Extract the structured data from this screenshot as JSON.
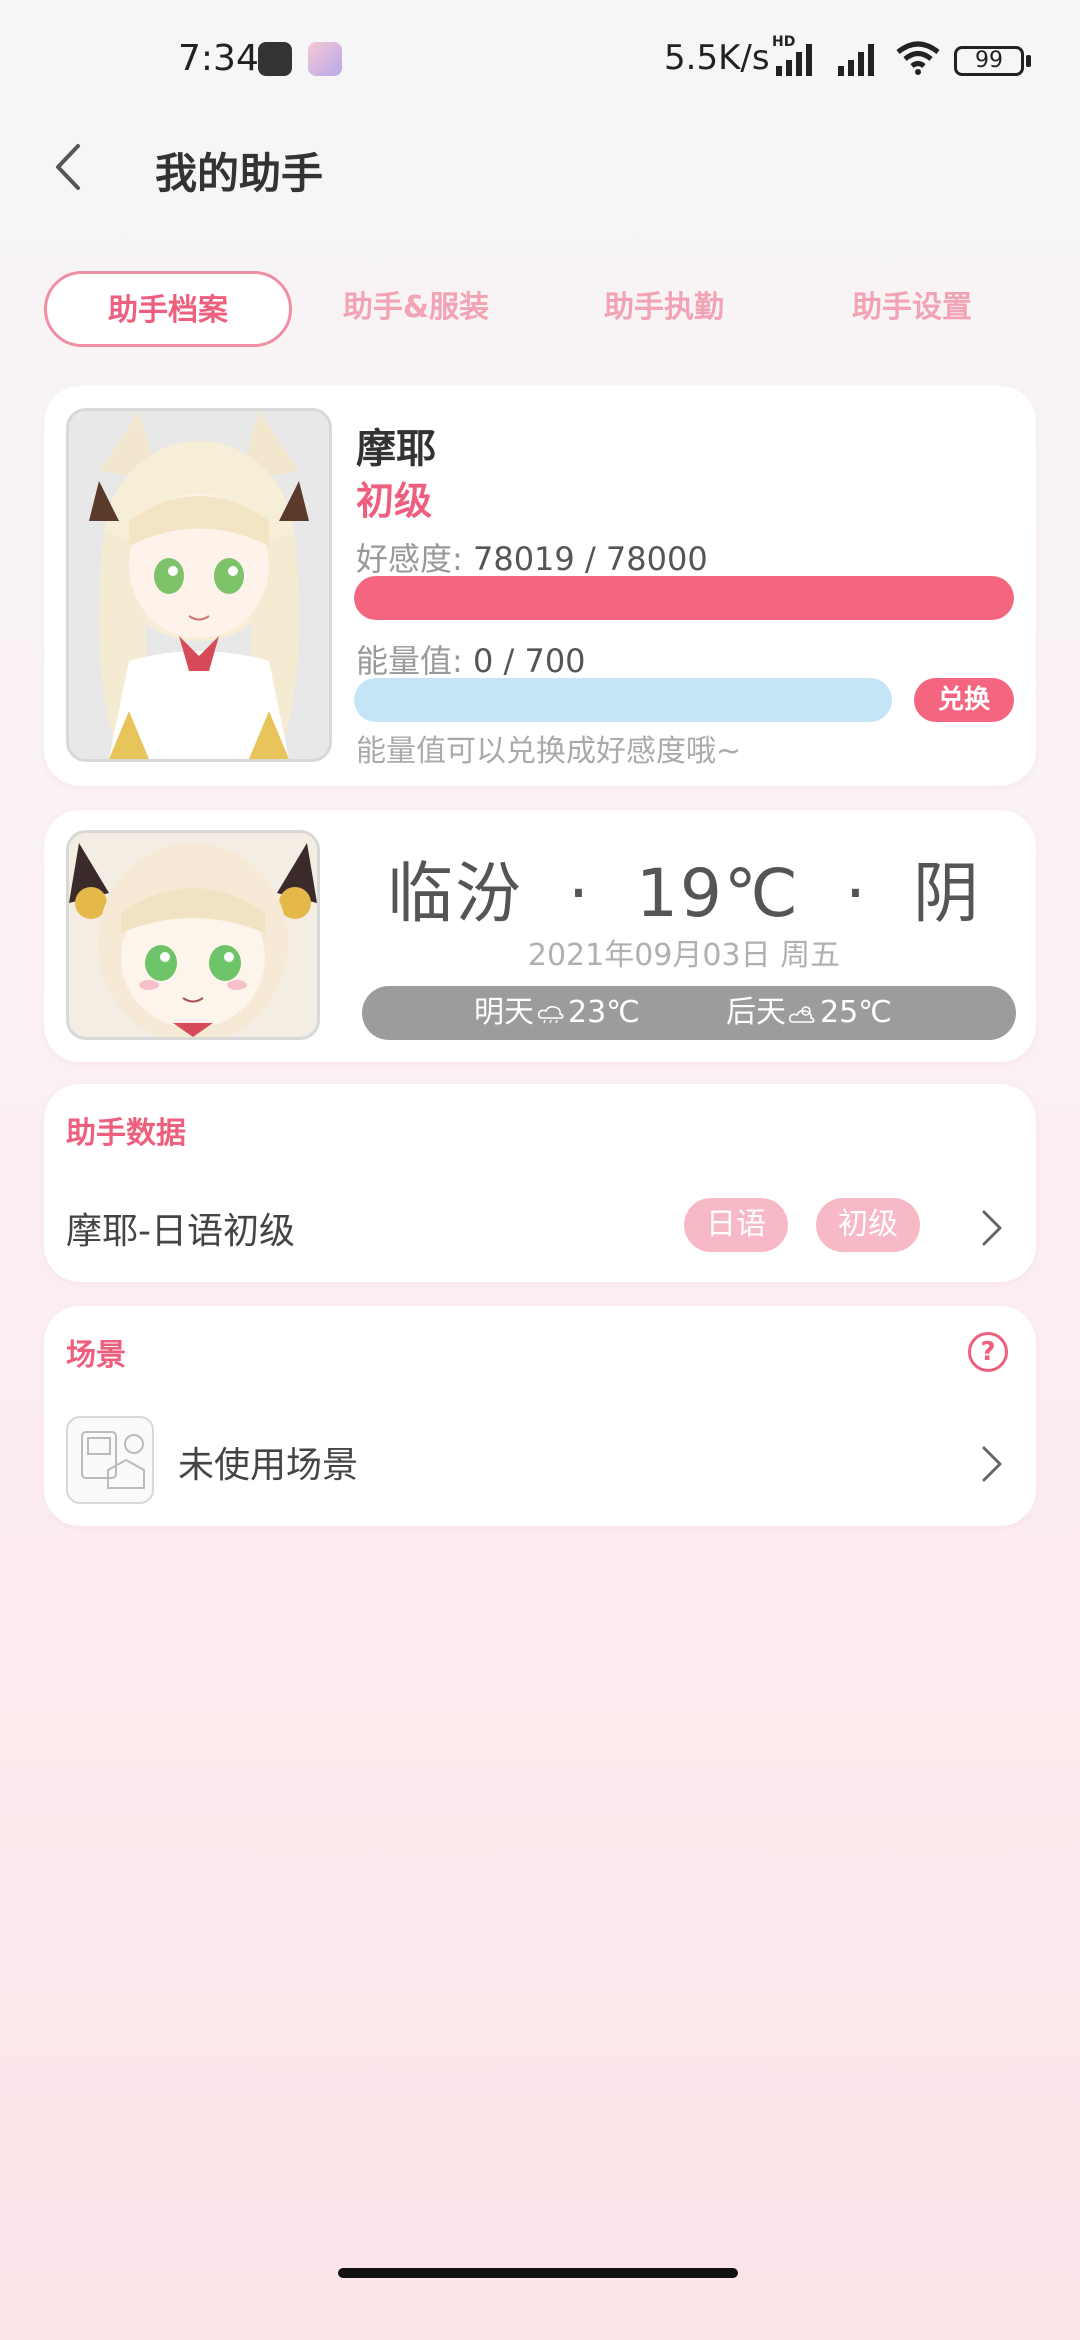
{
  "status_bar": {
    "time": "7:34",
    "network_speed": "5.5K/s",
    "hd": "HD",
    "battery": "99"
  },
  "header": {
    "title": "我的助手"
  },
  "tabs": [
    {
      "label": "助手档案",
      "active": true
    },
    {
      "label": "助手&服装",
      "active": false
    },
    {
      "label": "助手执勤",
      "active": false
    },
    {
      "label": "助手设置",
      "active": false
    }
  ],
  "profile": {
    "name": "摩耶",
    "level": "初级",
    "affinity_label": "好感度: ",
    "affinity_value": "78019 / 78000",
    "affinity_fraction": 1.0,
    "energy_label": "能量值: ",
    "energy_value": "0 / 700",
    "energy_fraction": 0.0,
    "exchange_label": "兑换",
    "energy_hint": "能量值可以兑换成好感度哦~"
  },
  "weather": {
    "city": "临汾",
    "separator": "·",
    "temperature": "19℃",
    "condition": "阴",
    "date": "2021年09月03日 周五",
    "tomorrow_label": "明天",
    "tomorrow_temp": "23℃",
    "after_tomorrow_label": "后天",
    "after_tomorrow_temp": "25℃"
  },
  "assistant_data": {
    "section_title": "助手数据",
    "name": "摩耶-日语初级",
    "tags": [
      "日语",
      "初级"
    ]
  },
  "scene": {
    "section_title": "场景",
    "label": "未使用场景"
  },
  "colors": {
    "accent": "#ee5f7e",
    "affinity_bar": "#f4667f",
    "energy_bar": "#c5e4f6",
    "tag_bg": "#f8b9c6"
  }
}
